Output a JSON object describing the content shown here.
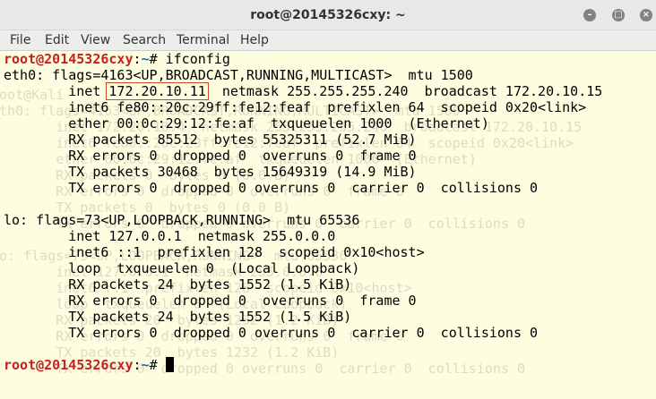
{
  "window": {
    "title": "root@20145326cxy: ~"
  },
  "menu": [
    "File",
    "Edit",
    "View",
    "Search",
    "Terminal",
    "Help"
  ],
  "prompt": {
    "user": "root@20145326cxy",
    "sep": ":",
    "path": "~",
    "symbol": "# "
  },
  "command": "ifconfig",
  "output": {
    "eth0_header": "eth0: flags=4163<UP,BROADCAST,RUNNING,MULTICAST>  mtu 1500",
    "eth0_inet_prefix": "        inet ",
    "eth0_ip": "172.20.10.11",
    "eth0_inet_suffix": "  netmask 255.255.255.240  broadcast 172.20.10.15",
    "eth0_inet6": "        inet6 fe80::20c:29ff:fe12:feaf  prefixlen 64  scopeid 0x20<link>",
    "eth0_ether": "        ether 00:0c:29:12:fe:af  txqueuelen 1000  (Ethernet)",
    "eth0_rx_packets": "        RX packets 85512  bytes 55325311 (52.7 MiB)",
    "eth0_rx_errors": "        RX errors 0  dropped 0  overruns 0  frame 0",
    "eth0_tx_packets": "        TX packets 30468  bytes 15649319 (14.9 MiB)",
    "eth0_tx_errors": "        TX errors 0  dropped 0 overruns 0  carrier 0  collisions 0",
    "lo_header": "lo: flags=73<UP,LOOPBACK,RUNNING>  mtu 65536",
    "lo_inet": "        inet 127.0.0.1  netmask 255.0.0.0",
    "lo_inet6": "        inet6 ::1  prefixlen 128  scopeid 0x10<host>",
    "lo_loop": "        loop  txqueuelen 0  (Local Loopback)",
    "lo_rx_packets": "        RX packets 24  bytes 1552 (1.5 KiB)",
    "lo_rx_errors": "        RX errors 0  dropped 0  overruns 0  frame 0",
    "lo_tx_packets": "        TX packets 24  bytes 1552 (1.5 KiB)",
    "lo_tx_errors": "        TX errors 0  dropped 0 overruns 0  carrier 0  collisions 0"
  },
  "colors": {
    "background": "#fdfde0",
    "prompt_user": "#c62020",
    "prompt_path": "#2c5fa8",
    "highlight_box": "#d04a2a"
  }
}
